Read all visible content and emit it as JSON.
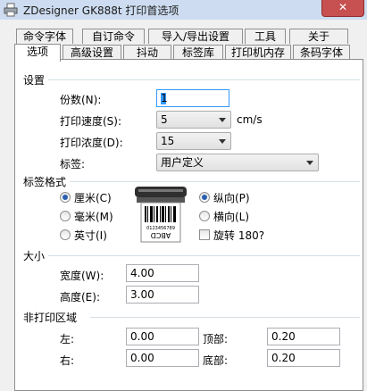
{
  "window": {
    "title": "ZDesigner GK888t 打印首选项",
    "close_label": "✕"
  },
  "tabs_row1": [
    "命令字体",
    "自订命令",
    "导入/导出设置",
    "工具",
    "关于"
  ],
  "tabs_row2": [
    "选项",
    "高级设置",
    "抖动",
    "标签库",
    "打印机内存",
    "条码字体"
  ],
  "settings": {
    "title": "设置",
    "copies_label": "份数(N):",
    "copies_value": "1",
    "speed_label": "打印速度(S):",
    "speed_value": "5",
    "speed_unit": "cm/s",
    "darkness_label": "打印浓度(D):",
    "darkness_value": "15",
    "label_label": "标签:",
    "label_value": "用户定义"
  },
  "label_format": {
    "title": "标签格式",
    "units": [
      {
        "label": "厘米(C)",
        "checked": true
      },
      {
        "label": "毫米(M)",
        "checked": false
      },
      {
        "label": "英寸(I)",
        "checked": false
      }
    ],
    "orientation": [
      {
        "label": "纵向(P)",
        "checked": true
      },
      {
        "label": "横向(L)",
        "checked": false
      }
    ],
    "rotate_label": "旋转 180?",
    "preview_text": "ABCD",
    "preview_small_text": "0123456789"
  },
  "size": {
    "title": "大小",
    "width_label": "宽度(W):",
    "width_value": "4.00",
    "height_label": "高度(E):",
    "height_value": "3.00"
  },
  "unprintable": {
    "title": "非打印区域",
    "left_label": "左:",
    "left_value": "0.00",
    "top_label": "顶部:",
    "top_value": "0.20",
    "right_label": "右:",
    "right_value": "0.00",
    "bottom_label": "底部:",
    "bottom_value": "0.20"
  },
  "colors": {
    "title_bar": "#cddcf0",
    "close_button": "#c75050",
    "radio_dot": "#2a5fb0"
  }
}
